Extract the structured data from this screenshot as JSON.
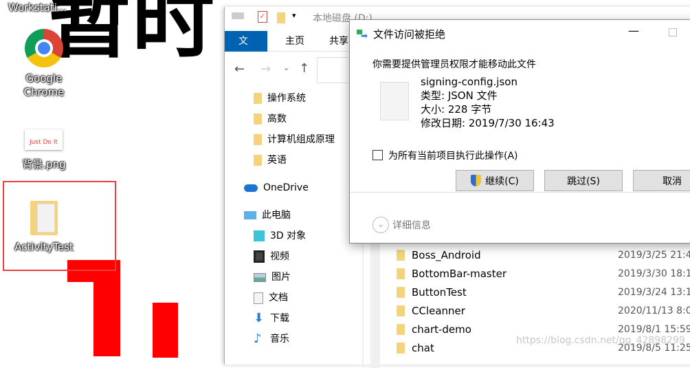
{
  "desktop": {
    "wallpaper_text": "暂时",
    "icons": [
      {
        "label": "Workstati..."
      },
      {
        "label": "Google Chrome"
      },
      {
        "label": "背景.png",
        "thumb_text": "Just Do It"
      },
      {
        "label": "ActivityTest"
      }
    ]
  },
  "explorer": {
    "title": "本地磁盘 (D:)",
    "ribbon_tabs": [
      "文件",
      "主页",
      "共享"
    ],
    "nav_pane": {
      "quick_access": [
        "操作系统",
        "高数",
        "计算机组成原理",
        "英语"
      ],
      "onedrive": "OneDrive",
      "this_pc": "此电脑",
      "pc_items": [
        "3D 对象",
        "视频",
        "图片",
        "文档",
        "下载",
        "音乐"
      ]
    },
    "files": [
      {
        "name": "Boss_Android",
        "date": "2019/3/25 21:4"
      },
      {
        "name": "BottomBar-master",
        "date": "2019/3/30 18:1"
      },
      {
        "name": "ButtonTest",
        "date": "2019/3/24 13:1"
      },
      {
        "name": "CCleanner",
        "date": "2020/11/13 8:0"
      },
      {
        "name": "chart-demo",
        "date": "2019/8/1 15:59"
      },
      {
        "name": "chat",
        "date": "2019/8/5 11:25"
      }
    ]
  },
  "dialog": {
    "title": "文件访问被拒绝",
    "message": "你需要提供管理员权限才能移动此文件",
    "file_name": "signing-config.json",
    "file_type": "类型: JSON 文件",
    "file_size": "大小: 228 字节",
    "file_modified": "修改日期: 2019/7/30 16:43",
    "checkbox_label": "为所有当前项目执行此操作(A)",
    "checkbox_checked": false,
    "continue_label": "继续(C)",
    "skip_label": "跳过(S)",
    "cancel_label": "取消",
    "details_label": "详细信息"
  },
  "watermark": "https://blog.csdn.net/qq_42898299",
  "colors": {
    "accent": "#0063b1",
    "highlight_box": "#f03c3c",
    "wallpaper_red": "#ff0000"
  }
}
